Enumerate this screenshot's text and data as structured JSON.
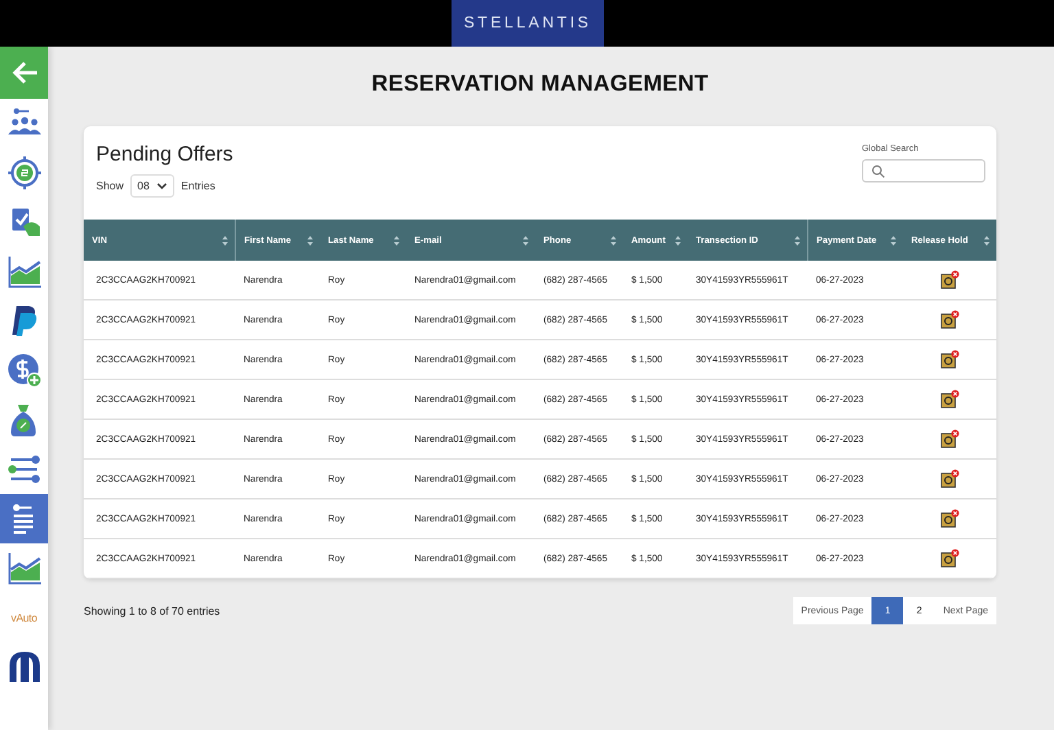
{
  "header": {
    "logo": "STELLANTIS"
  },
  "sidebar": {
    "items": [
      {
        "kind": "back",
        "selected": false
      },
      {
        "kind": "icon",
        "selected": false
      },
      {
        "kind": "icon",
        "selected": false
      },
      {
        "kind": "icon",
        "selected": false
      },
      {
        "kind": "icon",
        "selected": false
      },
      {
        "kind": "icon",
        "selected": false
      },
      {
        "kind": "icon",
        "selected": false
      },
      {
        "kind": "icon",
        "selected": false
      },
      {
        "kind": "icon",
        "selected": false
      },
      {
        "kind": "icon",
        "selected": true
      },
      {
        "kind": "icon",
        "selected": false
      },
      {
        "kind": "text",
        "label": "vAuto",
        "selected": false
      },
      {
        "kind": "icon",
        "selected": false
      }
    ]
  },
  "page_title": "RESERVATION MANAGEMENT",
  "card": {
    "title": "Pending Offers",
    "show_label": "Show",
    "page_size": "08",
    "entries_label": "Entries",
    "search": {
      "label": "Global Search"
    }
  },
  "table": {
    "columns": [
      "VIN",
      "First Name",
      "Last Name",
      "E-mail",
      "Phone",
      "Amount",
      "Transection ID",
      "Payment Date",
      "Release Hold"
    ],
    "rows": [
      [
        "2C3CCAAG2KH700921",
        "Narendra",
        "Roy",
        "Narendra01@gmail.com",
        "(682) 287-4565",
        "$ 1,500",
        "30Y41593YR555961T",
        "06-27-2023"
      ],
      [
        "2C3CCAAG2KH700921",
        "Narendra",
        "Roy",
        "Narendra01@gmail.com",
        "(682) 287-4565",
        "$ 1,500",
        "30Y41593YR555961T",
        "06-27-2023"
      ],
      [
        "2C3CCAAG2KH700921",
        "Narendra",
        "Roy",
        "Narendra01@gmail.com",
        "(682) 287-4565",
        "$ 1,500",
        "30Y41593YR555961T",
        "06-27-2023"
      ],
      [
        "2C3CCAAG2KH700921",
        "Narendra",
        "Roy",
        "Narendra01@gmail.com",
        "(682) 287-4565",
        "$ 1,500",
        "30Y41593YR555961T",
        "06-27-2023"
      ],
      [
        "2C3CCAAG2KH700921",
        "Narendra",
        "Roy",
        "Narendra01@gmail.com",
        "(682) 287-4565",
        "$ 1,500",
        "30Y41593YR555961T",
        "06-27-2023"
      ],
      [
        "2C3CCAAG2KH700921",
        "Narendra",
        "Roy",
        "Narendra01@gmail.com",
        "(682) 287-4565",
        "$ 1,500",
        "30Y41593YR555961T",
        "06-27-2023"
      ],
      [
        "2C3CCAAG2KH700921",
        "Narendra",
        "Roy",
        "Narendra01@gmail.com",
        "(682) 287-4565",
        "$ 1,500",
        "30Y41593YR555961T",
        "06-27-2023"
      ],
      [
        "2C3CCAAG2KH700921",
        "Narendra",
        "Roy",
        "Narendra01@gmail.com",
        "(682) 287-4565",
        "$ 1,500",
        "30Y41593YR555961T",
        "06-27-2023"
      ]
    ]
  },
  "footer": {
    "summary": "Showing 1 to 8 of 70 entries",
    "pagination": {
      "previous": "Previous Page",
      "pages": [
        {
          "label": "1",
          "selected": true
        },
        {
          "label": "2",
          "selected": false
        }
      ],
      "next": "Next Page"
    }
  }
}
